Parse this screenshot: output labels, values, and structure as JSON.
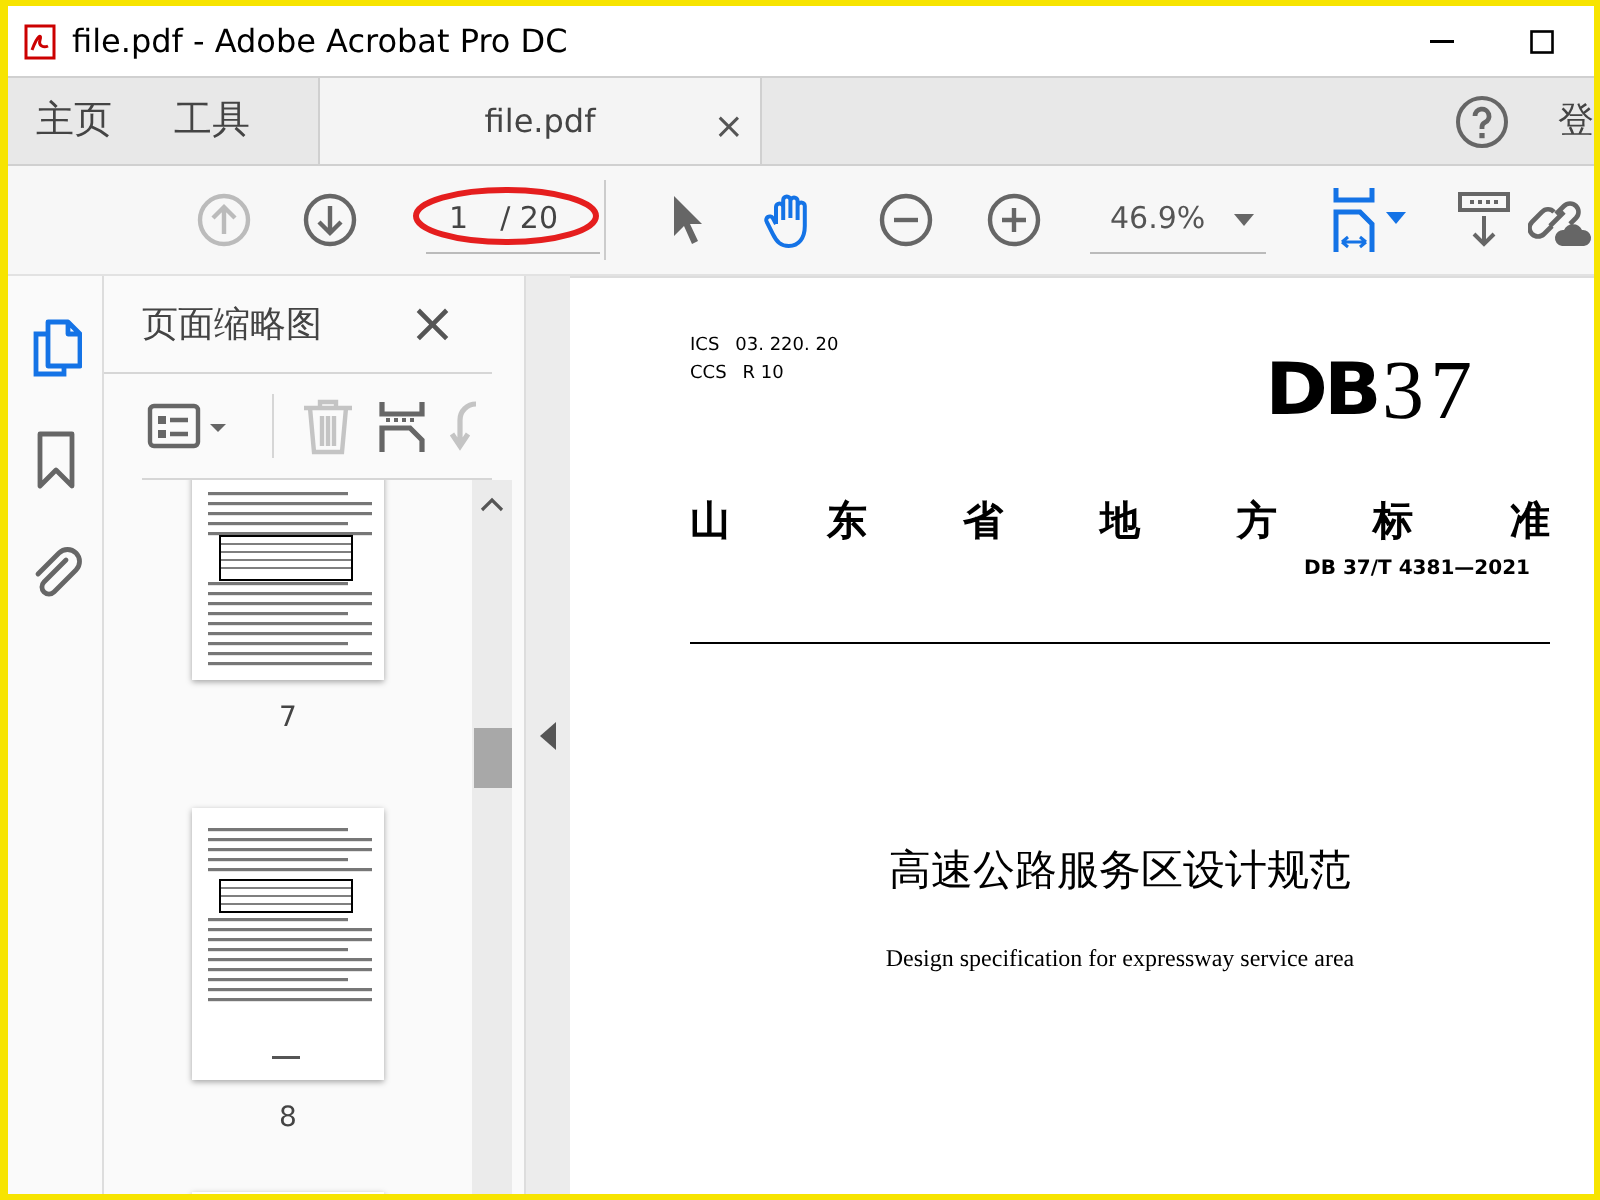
{
  "window": {
    "title": "file.pdf - Adobe Acrobat Pro DC"
  },
  "tabs": [
    {
      "label": "主页",
      "selected": false
    },
    {
      "label": "工具",
      "selected": false
    },
    {
      "label": "file.pdf",
      "selected": true,
      "close": "×"
    }
  ],
  "account": {
    "label": "登"
  },
  "toolbar": {
    "items": [
      {
        "kind": "prev",
        "disabled": true
      },
      {
        "kind": "next",
        "disabled": false
      },
      {
        "kind": "page",
        "current": "1",
        "total": "/ 20"
      },
      {
        "kind": "select",
        "selected": false
      },
      {
        "kind": "hand",
        "selected": true
      },
      {
        "kind": "zoom-out",
        "disabled": false
      },
      {
        "kind": "zoom-in",
        "disabled": false
      },
      {
        "kind": "zoom",
        "value": "46.9%"
      },
      {
        "kind": "fit",
        "disabled": false
      },
      {
        "kind": "scroll",
        "disabled": false
      },
      {
        "kind": "share",
        "disabled": false
      }
    ]
  },
  "sidebar": {
    "items": [
      {
        "kind": "pages",
        "selected": true
      },
      {
        "kind": "bookmarks",
        "selected": false
      },
      {
        "kind": "attachments",
        "selected": false
      }
    ]
  },
  "thumbnails_panel": {
    "title": "页面缩略图",
    "close": "×",
    "tools": [
      {
        "kind": "options",
        "disabled": false
      },
      {
        "kind": "delete",
        "disabled": true
      },
      {
        "kind": "extract",
        "disabled": false
      },
      {
        "kind": "rotate",
        "disabled": true
      }
    ],
    "pages": [
      {
        "label": "7",
        "selected": false
      },
      {
        "label": "8",
        "selected": false
      }
    ]
  },
  "document": {
    "ics_label": "ICS",
    "ics": "03. 220. 20",
    "ccs_label": "CCS",
    "ccs": "R 10",
    "logo_letters": "DB",
    "logo_number": "37",
    "issuer": "山东省地方标准",
    "code": "DB 37/T 4381—2021",
    "title": "高速公路服务区设计规范",
    "subtitle": "Design specification for expressway service area"
  }
}
